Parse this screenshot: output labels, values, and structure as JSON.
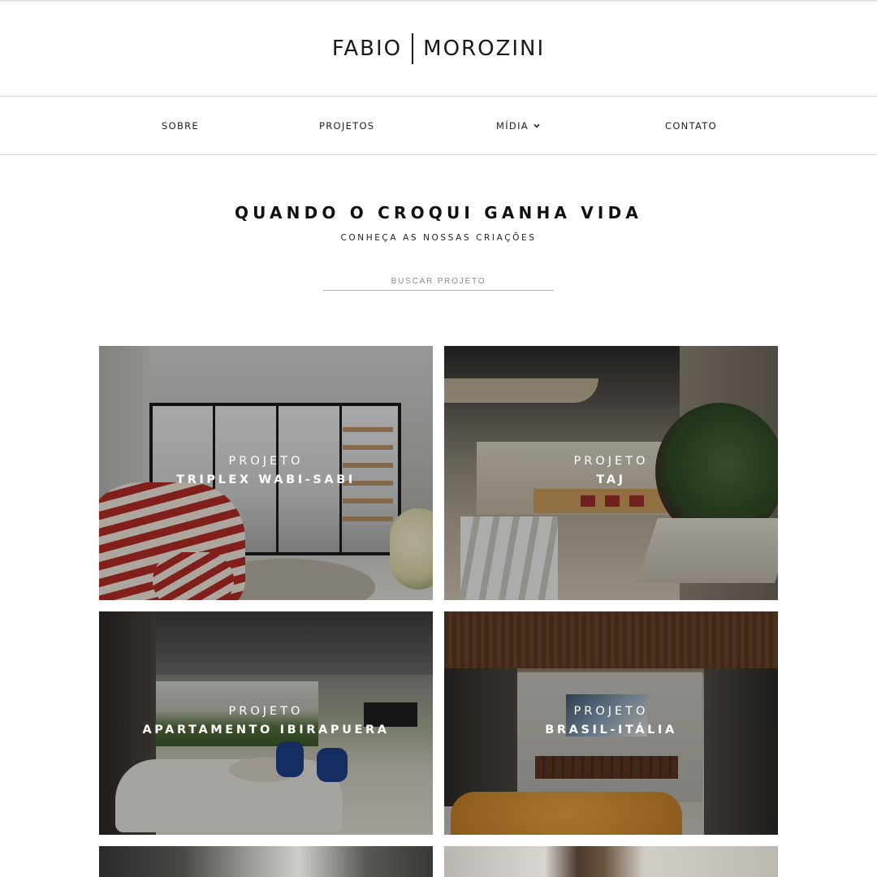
{
  "brand": {
    "first": "FABIO",
    "last": "MOROZINI"
  },
  "nav": {
    "items": [
      {
        "label": "SOBRE"
      },
      {
        "label": "PROJETOS"
      },
      {
        "label": "MÍDIA"
      },
      {
        "label": "CONTATO"
      }
    ]
  },
  "hero": {
    "title": "QUANDO O CROQUI GANHA VIDA",
    "subtitle": "CONHEÇA AS NOSSAS CRIAÇÕES"
  },
  "search": {
    "placeholder": "BUSCAR PROJETO"
  },
  "projects": [
    {
      "kicker": "PROJETO",
      "name": "TRIPLEX WABI-SABI"
    },
    {
      "kicker": "PROJETO",
      "name": "TAJ"
    },
    {
      "kicker": "PROJETO",
      "name": "APARTAMENTO IBIRAPUERA"
    },
    {
      "kicker": "PROJETO",
      "name": "BRASIL-ITÁLIA"
    }
  ],
  "icons": {
    "media_dropdown": "chevron-down-icon"
  }
}
